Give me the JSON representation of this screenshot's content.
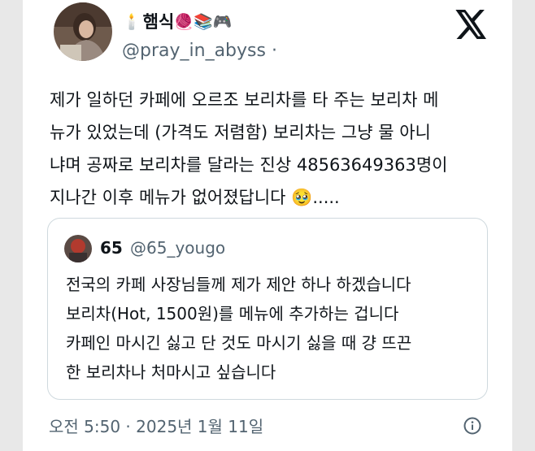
{
  "author": {
    "name_emoji_prefix": "🕯️",
    "display_name": "햄식",
    "name_emoji_suffix": "🧶📚🎮",
    "handle": "@pray_in_abyss",
    "handle_suffix": " ·"
  },
  "post": {
    "text": "제가 일하던 카페에 오르조 보리차를 타 주는 보리차 메\n뉴가 있었는데 (가격도 저렴함) 보리차는 그냥 물 아니\n냐며 공짜로 보리차를 달라는 진상 48563649363명이\n지나간 이후 메뉴가 없어졌답니다 ",
    "trailing_emoji": "🥹",
    "trailing_text": ".....",
    "timestamp": "오전 5:50 · 2025년 1월 11일"
  },
  "quoted": {
    "display_name": "65",
    "handle": "@65_yougo",
    "text": "전국의 카페 사장님들께 제가 제안 하나 하겠습니다\n보리차(Hot, 1500원)를 메뉴에 추가하는 겁니다\n카페인 마시긴 싫고 단 것도 마시기 싫을 때 걍 뜨끈\n한 보리차나 처마시고 싶습니다"
  },
  "icons": {
    "logo": "x-logo-icon",
    "info": "info-icon"
  },
  "colors": {
    "text": "#0f1419",
    "secondary": "#536471",
    "border": "#cfd9de",
    "background": "#ffffff"
  }
}
